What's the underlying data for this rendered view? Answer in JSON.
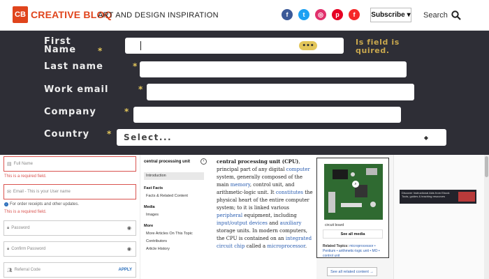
{
  "header": {
    "logo_badge": "CB",
    "logo_text": "CREATIVE BLOQ",
    "tagline": "ART AND DESIGN INSPIRATION",
    "social": [
      {
        "icon": "facebook-icon",
        "glyph": "f",
        "color": "#3b5998"
      },
      {
        "icon": "twitter-icon",
        "glyph": "t",
        "color": "#1da1f2"
      },
      {
        "icon": "instagram-icon",
        "glyph": "◎",
        "color": "#e1306c"
      },
      {
        "icon": "pinterest-icon",
        "glyph": "p",
        "color": "#e60023"
      },
      {
        "icon": "flipboard-icon",
        "glyph": "f",
        "color": "#f52828"
      }
    ],
    "subscribe_label": "Subscribe",
    "search_label": "Search"
  },
  "signup_form": {
    "first_name_label": "First\nName",
    "first_name_error": "Is field is\nquired.",
    "last_name_label": "Last name",
    "work_email_label": "Work email",
    "company_label": "Company",
    "country_label": "Country",
    "country_value": "Select...",
    "required_marker": "*"
  },
  "account_form": {
    "full_name_placeholder": "Full Name",
    "full_name_error": "This is a required field.",
    "email_placeholder": "Email - This is your User name",
    "email_info": "For order receipts and other updates.",
    "email_error": "This is a required field.",
    "password_placeholder": "Password",
    "confirm_password_placeholder": "Confirm Password",
    "referral_placeholder": "Referral Code",
    "apply_label": "APPLY"
  },
  "article_nav": {
    "title": "central processing unit",
    "intro": "Introduction",
    "facts_heading": "Fast Facts",
    "facts_item": "Facts & Related Content",
    "media_heading": "Media",
    "media_item": "Images",
    "more_heading": "More",
    "more_items": [
      "More Articles On This Topic",
      "Contributors",
      "Article History"
    ]
  },
  "article": {
    "term": "central processing unit (CPU)",
    "text_1": ", principal part of any digital ",
    "link_computer": "computer",
    "text_2": " system, generally composed of the main ",
    "link_memory": "memory",
    "text_3": ", control unit, and arithmetic-logic unit. It ",
    "link_constitutes": "constitutes",
    "text_4": " the physical heart of the entire computer system; to it is linked various ",
    "link_peripheral": "peripheral",
    "text_5": " equipment, including ",
    "link_io": "input/output devices",
    "text_6": " and ",
    "link_auxiliary": "auxiliary",
    "text_7": " storage units. In modern computers, the CPU is contained on an ",
    "link_ic": "integrated circuit chip",
    "text_8": " called a ",
    "link_micro": "microprocessor",
    "text_9": "."
  },
  "figure": {
    "caption": "circuit board",
    "see_media": "See all media",
    "related_label": "Related Topics:",
    "related_items": "microprocessor • Pentium • arithmetic-logic unit • MO • control unit",
    "see_content": "See all related content →"
  },
  "ad": {
    "text": "Discover Instructional Aids from Ebook Tools, guides & teaching resources"
  }
}
